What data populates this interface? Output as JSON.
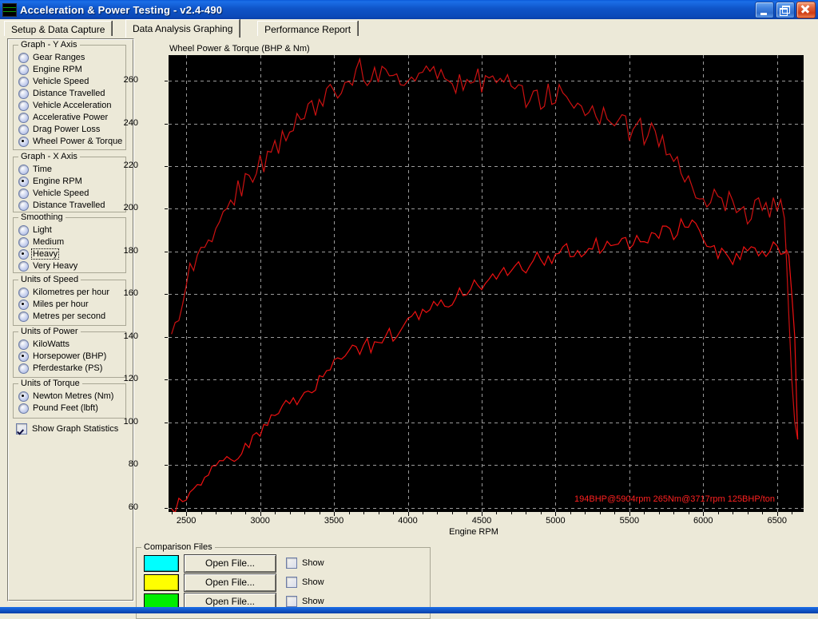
{
  "window": {
    "title": "Acceleration & Power Testing - v2.4-490",
    "icon": "app-graph-icon",
    "buttons": {
      "minimize": "minimize",
      "restore": "restore",
      "close": "close"
    }
  },
  "tabs": [
    {
      "label": "Setup & Data Capture",
      "active": false
    },
    {
      "label": "Data Analysis Graphing",
      "active": true
    },
    {
      "label": "Performance Report",
      "active": false
    }
  ],
  "sidebar": {
    "groups": [
      {
        "key": "y_axis",
        "title": "Graph - Y Axis",
        "options": [
          {
            "label": "Gear Ranges",
            "selected": false
          },
          {
            "label": "Engine RPM",
            "selected": false
          },
          {
            "label": "Vehicle Speed",
            "selected": false
          },
          {
            "label": "Distance Travelled",
            "selected": false
          },
          {
            "label": "Vehicle Acceleration",
            "selected": false
          },
          {
            "label": "Accelerative Power",
            "selected": false
          },
          {
            "label": "Drag Power Loss",
            "selected": false
          },
          {
            "label": "Wheel Power & Torque",
            "selected": true
          }
        ]
      },
      {
        "key": "x_axis",
        "title": "Graph - X Axis",
        "options": [
          {
            "label": "Time",
            "selected": false
          },
          {
            "label": "Engine RPM",
            "selected": true
          },
          {
            "label": "Vehicle Speed",
            "selected": false
          },
          {
            "label": "Distance Travelled",
            "selected": false
          }
        ]
      },
      {
        "key": "smoothing",
        "title": "Smoothing",
        "options": [
          {
            "label": "Light",
            "selected": false
          },
          {
            "label": "Medium",
            "selected": false
          },
          {
            "label": "Heavy",
            "selected": true,
            "focused": true
          },
          {
            "label": "Very Heavy",
            "selected": false
          }
        ]
      },
      {
        "key": "units_speed",
        "title": "Units of Speed",
        "options": [
          {
            "label": "Kilometres per hour",
            "selected": false
          },
          {
            "label": "Miles per hour",
            "selected": true
          },
          {
            "label": "Metres per second",
            "selected": false
          }
        ]
      },
      {
        "key": "units_power",
        "title": "Units of Power",
        "options": [
          {
            "label": "KiloWatts",
            "selected": false
          },
          {
            "label": "Horsepower (BHP)",
            "selected": true
          },
          {
            "label": "Pferdestarke (PS)",
            "selected": false
          }
        ]
      },
      {
        "key": "units_torque",
        "title": "Units of Torque",
        "options": [
          {
            "label": "Newton Metres (Nm)",
            "selected": true
          },
          {
            "label": "Pound Feet (lbft)",
            "selected": false
          }
        ]
      }
    ],
    "show_statistics": {
      "label": "Show Graph Statistics",
      "checked": true
    }
  },
  "comparison": {
    "title": "Comparison Files",
    "rows": [
      {
        "color": "#00ffff",
        "button": "Open File...",
        "show_label": "Show",
        "show_checked": false
      },
      {
        "color": "#ffff00",
        "button": "Open File...",
        "show_label": "Show",
        "show_checked": false
      },
      {
        "color": "#00ee00",
        "button": "Open File...",
        "show_label": "Show",
        "show_checked": false
      }
    ]
  },
  "chart_data": {
    "type": "line",
    "title": "Wheel Power & Torque (BHP & Nm)",
    "xlabel": "Engine RPM",
    "ylabel": "",
    "xlim": [
      2380,
      6680
    ],
    "ylim": [
      58,
      272
    ],
    "xticks": [
      2500,
      3000,
      3500,
      4000,
      4500,
      5000,
      5500,
      6000,
      6500
    ],
    "yticks": [
      60,
      80,
      100,
      120,
      140,
      160,
      180,
      200,
      220,
      240,
      260
    ],
    "grid": true,
    "grid_style": "dashed",
    "grid_color": "#9a9a9a",
    "background": "#000000",
    "legend": "none",
    "annotation": "194BHP@5904rpm 265Nm@3717rpm 125BHP/ton",
    "annotation_color": "#ff2020",
    "series": [
      {
        "name": "Wheel Torque (Nm)",
        "color": "#cc1111",
        "x": [
          2400,
          2450,
          2500,
          2550,
          2600,
          2650,
          2700,
          2750,
          2800,
          2850,
          2900,
          2950,
          3000,
          3050,
          3100,
          3150,
          3200,
          3250,
          3300,
          3350,
          3400,
          3450,
          3500,
          3550,
          3600,
          3650,
          3700,
          3750,
          3800,
          3850,
          3900,
          3950,
          4000,
          4050,
          4100,
          4150,
          4200,
          4250,
          4300,
          4350,
          4400,
          4450,
          4500,
          4550,
          4600,
          4650,
          4700,
          4750,
          4800,
          4850,
          4900,
          4950,
          5000,
          5050,
          5100,
          5150,
          5200,
          5250,
          5300,
          5350,
          5400,
          5450,
          5500,
          5550,
          5600,
          5650,
          5700,
          5750,
          5800,
          5850,
          5900,
          5950,
          6000,
          6050,
          6100,
          6150,
          6200,
          6250,
          6300,
          6350,
          6400,
          6450,
          6500,
          6550,
          6580,
          6600,
          6620,
          6640
        ],
        "y": [
          140,
          152,
          163,
          173,
          180,
          186,
          192,
          198,
          203,
          208,
          213,
          217,
          221,
          226,
          230,
          234,
          238,
          241,
          244,
          248,
          251,
          254,
          257,
          259,
          262,
          264,
          265,
          263,
          261,
          263,
          259,
          262,
          260,
          263,
          264,
          262,
          259,
          263,
          258,
          261,
          259,
          262,
          257,
          260,
          255,
          261,
          256,
          259,
          253,
          258,
          252,
          256,
          250,
          254,
          248,
          252,
          246,
          250,
          243,
          246,
          240,
          244,
          237,
          241,
          234,
          238,
          231,
          228,
          222,
          218,
          214,
          210,
          207,
          205,
          203,
          204,
          202,
          200,
          198,
          200,
          202,
          201,
          200,
          199,
          150,
          120,
          100,
          92
        ]
      },
      {
        "name": "Wheel Power (BHP)",
        "color": "#ee1111",
        "x": [
          2400,
          2450,
          2500,
          2550,
          2600,
          2650,
          2700,
          2750,
          2800,
          2850,
          2900,
          2950,
          3000,
          3050,
          3100,
          3150,
          3200,
          3250,
          3300,
          3350,
          3400,
          3450,
          3500,
          3550,
          3600,
          3650,
          3700,
          3750,
          3800,
          3850,
          3900,
          3950,
          4000,
          4050,
          4100,
          4150,
          4200,
          4250,
          4300,
          4350,
          4400,
          4450,
          4500,
          4550,
          4600,
          4650,
          4700,
          4750,
          4800,
          4850,
          4900,
          4950,
          5000,
          5050,
          5100,
          5150,
          5200,
          5250,
          5300,
          5350,
          5400,
          5450,
          5500,
          5550,
          5600,
          5650,
          5700,
          5750,
          5800,
          5850,
          5900,
          5950,
          6000,
          6050,
          6100,
          6150,
          6200,
          6250,
          6300,
          6350,
          6400,
          6450,
          6500,
          6550,
          6580,
          6600,
          6620,
          6640
        ],
        "y": [
          60,
          63,
          66,
          69,
          72,
          75,
          78,
          81,
          84,
          87,
          90,
          93,
          96,
          99,
          102,
          105,
          108,
          111,
          114,
          117,
          120,
          123,
          126,
          128,
          131,
          134,
          137,
          136,
          139,
          142,
          140,
          145,
          147,
          150,
          153,
          151,
          155,
          158,
          156,
          161,
          159,
          164,
          162,
          168,
          166,
          172,
          170,
          174,
          172,
          177,
          175,
          179,
          177,
          181,
          179,
          182,
          180,
          184,
          181,
          185,
          182,
          186,
          183,
          188,
          185,
          190,
          187,
          191,
          188,
          193,
          190,
          194,
          186,
          182,
          178,
          180,
          176,
          179,
          181,
          178,
          182,
          180,
          183,
          181,
          178,
          160,
          140,
          92
        ]
      }
    ]
  }
}
